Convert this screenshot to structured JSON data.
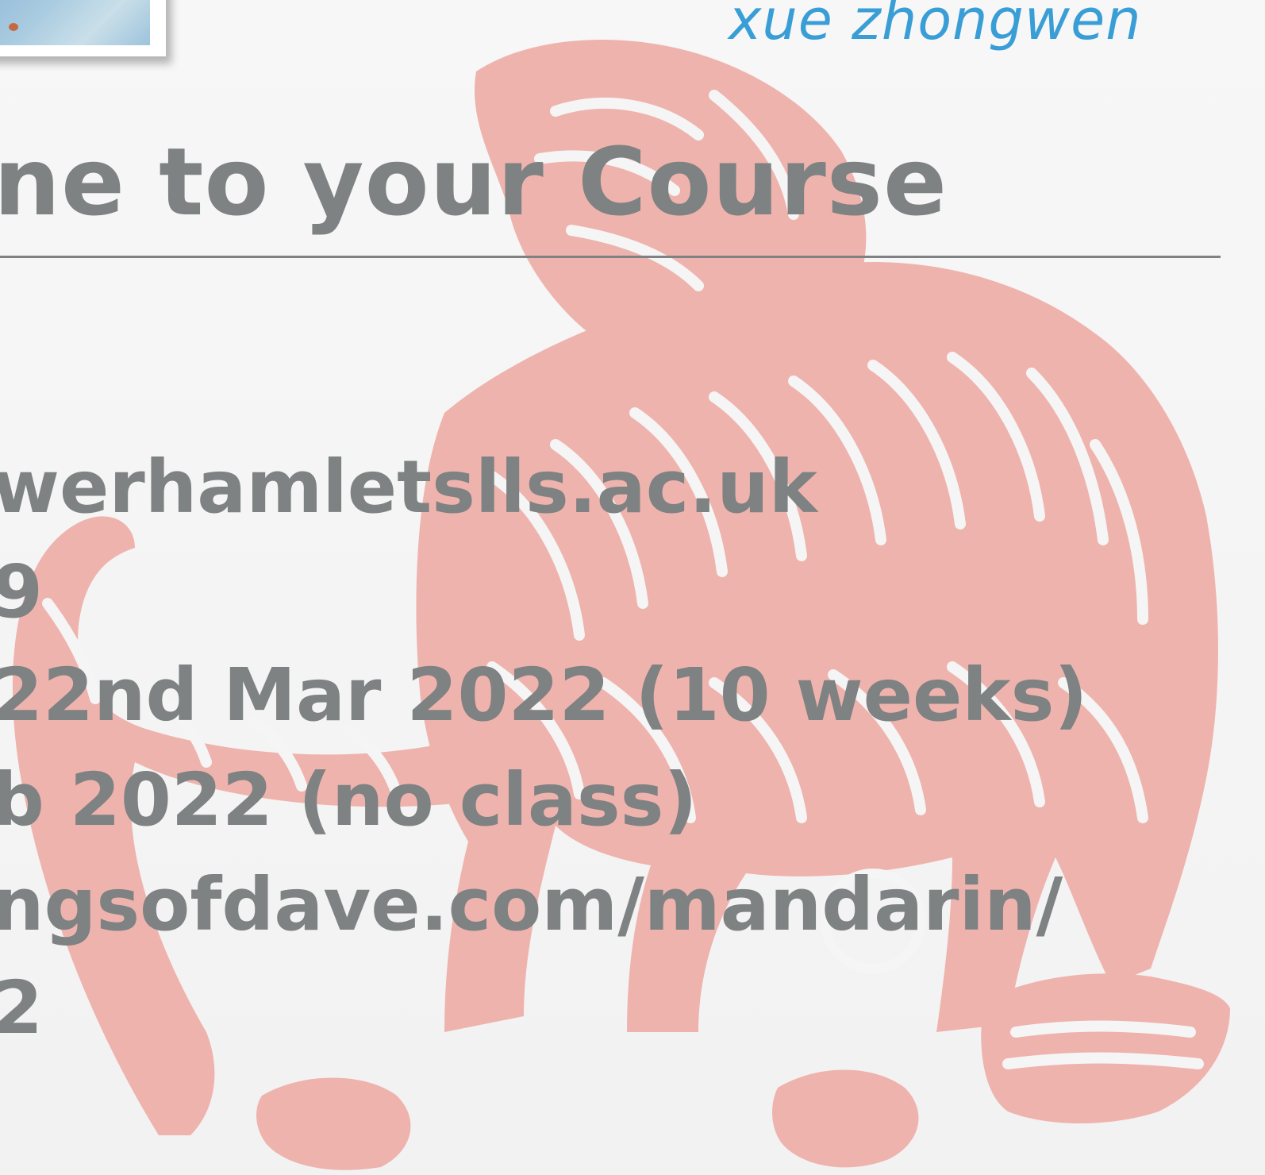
{
  "header": {
    "pinyin": "xue zhongwen"
  },
  "title": "ne to your Course",
  "info_lines": [
    "werhamletslls.ac.uk",
    "9",
    "22nd Mar 2022 (10 weeks)",
    "b 2022 (no class)",
    "ngsofdave.com/mandarin/",
    "2"
  ],
  "colors": {
    "pinyin": "#3a9ed6",
    "text": "#7e8282",
    "watermark": "#efb3ae",
    "background": "#f6f6f6"
  },
  "decorations": {
    "watermark": "tiger-papercut",
    "corner_image": "photo"
  }
}
